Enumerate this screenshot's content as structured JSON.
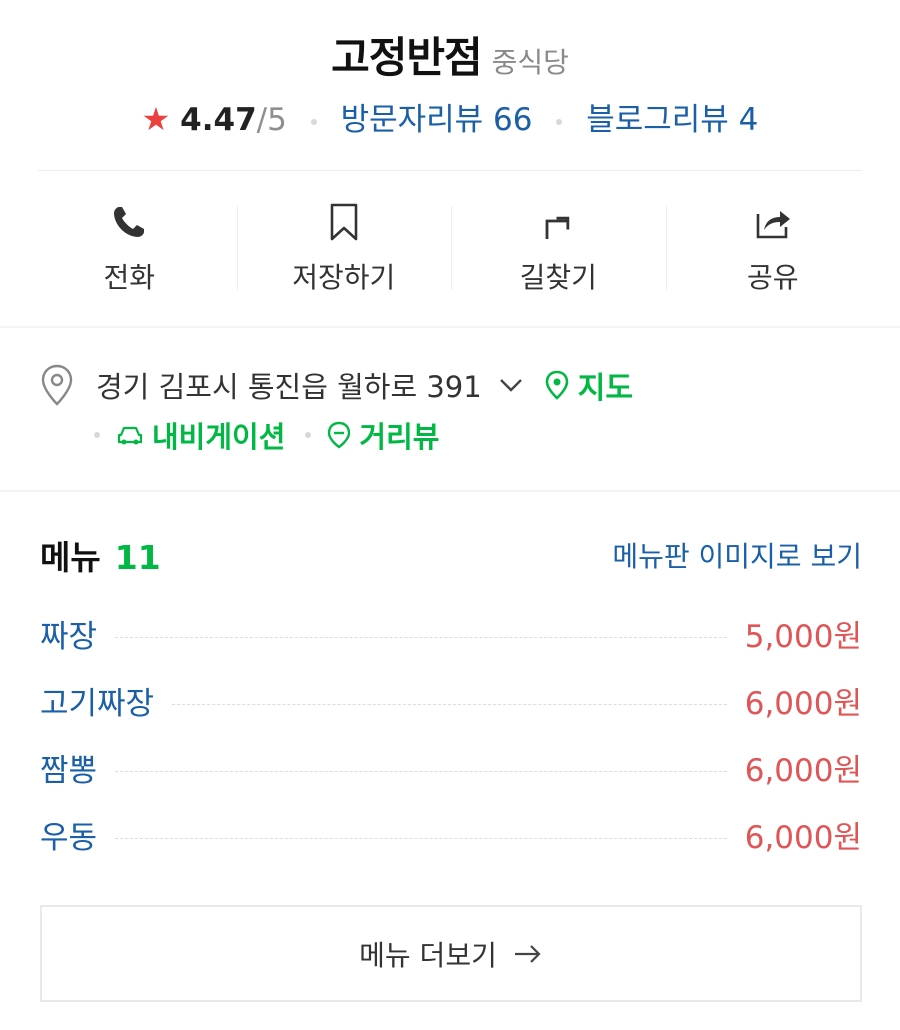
{
  "place": {
    "name": "고정반점",
    "category": "중식당"
  },
  "rating": {
    "score": "4.47",
    "max": "/5",
    "visitor_review_label": "방문자리뷰 66",
    "blog_review_label": "블로그리뷰 4",
    "star_color": "#ec3f3f"
  },
  "actions": [
    {
      "label": "전화",
      "icon": "phone-icon"
    },
    {
      "label": "저장하기",
      "icon": "bookmark-icon"
    },
    {
      "label": "길찾기",
      "icon": "directions-icon"
    },
    {
      "label": "공유",
      "icon": "share-icon"
    }
  ],
  "address": {
    "text": "경기 김포시 통진읍 월하로 391",
    "map_label": "지도",
    "navigation_label": "내비게이션",
    "street_view_label": "거리뷰"
  },
  "menu": {
    "title": "메뉴",
    "count": "11",
    "image_link_label": "메뉴판 이미지로 보기",
    "items": [
      {
        "name": "짜장",
        "price": "5,000원"
      },
      {
        "name": "고기짜장",
        "price": "6,000원"
      },
      {
        "name": "짬뽕",
        "price": "6,000원"
      },
      {
        "name": "우동",
        "price": "6,000원"
      }
    ],
    "more_label": "메뉴 더보기"
  },
  "colors": {
    "link_blue": "#1a5fa8",
    "accent_green": "#00b843",
    "price_red": "#e05555"
  }
}
